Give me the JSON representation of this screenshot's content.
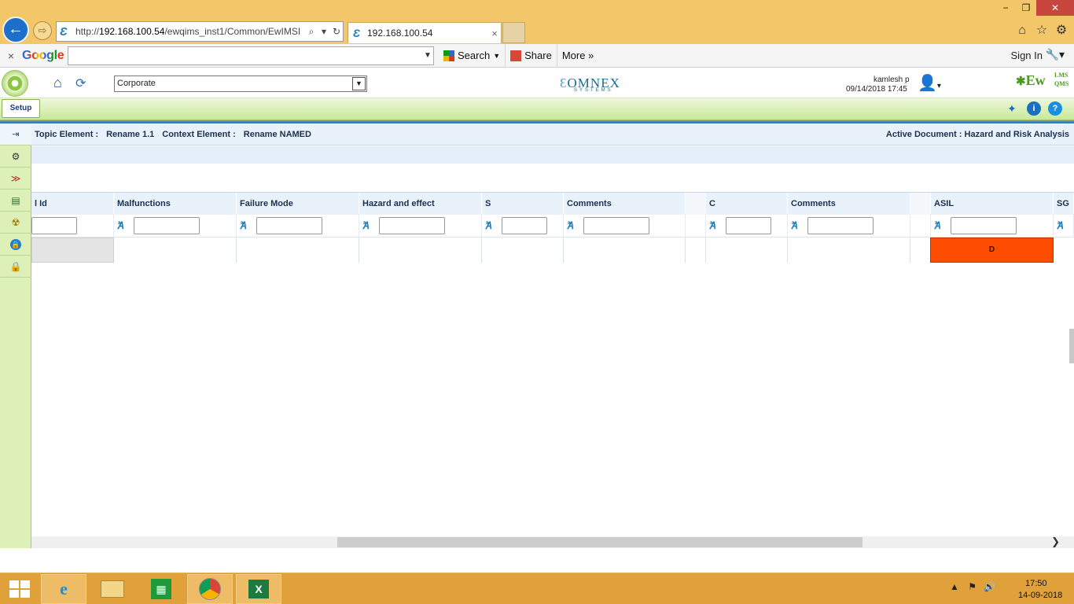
{
  "browser": {
    "url_prefix": "http://",
    "url_host": "192.168.100.54",
    "url_path": "/ewqims_inst1/Common/EwIMSI",
    "tab_title": "192.168.100.54",
    "tab_close": "×",
    "back_glyph": "←",
    "forward_glyph": "⇨",
    "min_glyph": "−",
    "max_glyph": "❐",
    "close_glyph": "✕"
  },
  "google_bar": {
    "close": "×",
    "logo": "Google",
    "search_label": "Search",
    "share_label": "Share",
    "more_label": "More »",
    "signin_label": "Sign In"
  },
  "app_header": {
    "company_select": "Corporate",
    "omnex_logo": "OMNEX",
    "omnex_sub": "SYSTEMS",
    "user_name": "kamlesh p",
    "user_date": "09/14/2018 17:45",
    "brand_ew": "Ew",
    "brand_lms": "LMS",
    "brand_qms": "QMS"
  },
  "nav": {
    "setup_tab": "Setup"
  },
  "info_bar": {
    "topic_label": "Topic Element :",
    "topic_value": "Rename 1.1",
    "context_label": "Context Element :",
    "context_value": "Rename NAMED",
    "active_document": "Active Document : Hazard and Risk Analysis"
  },
  "grid": {
    "columns": [
      {
        "label": "l Id"
      },
      {
        "label": "Malfunctions"
      },
      {
        "label": "Failure Mode"
      },
      {
        "label": "Hazard and effect"
      },
      {
        "label": "S"
      },
      {
        "label": "Comments"
      },
      {
        "label": ""
      },
      {
        "label": "C"
      },
      {
        "label": "Comments"
      },
      {
        "label": ""
      },
      {
        "label": "ASIL"
      },
      {
        "label": "SG"
      }
    ],
    "asil_value": "D"
  },
  "taskbar": {
    "time": "17:50",
    "date": "14-09-2018"
  },
  "colors": {
    "asil_high": "#fe4d00",
    "header_bg": "#e9f2fa",
    "green_bar": "#c9e89a"
  }
}
